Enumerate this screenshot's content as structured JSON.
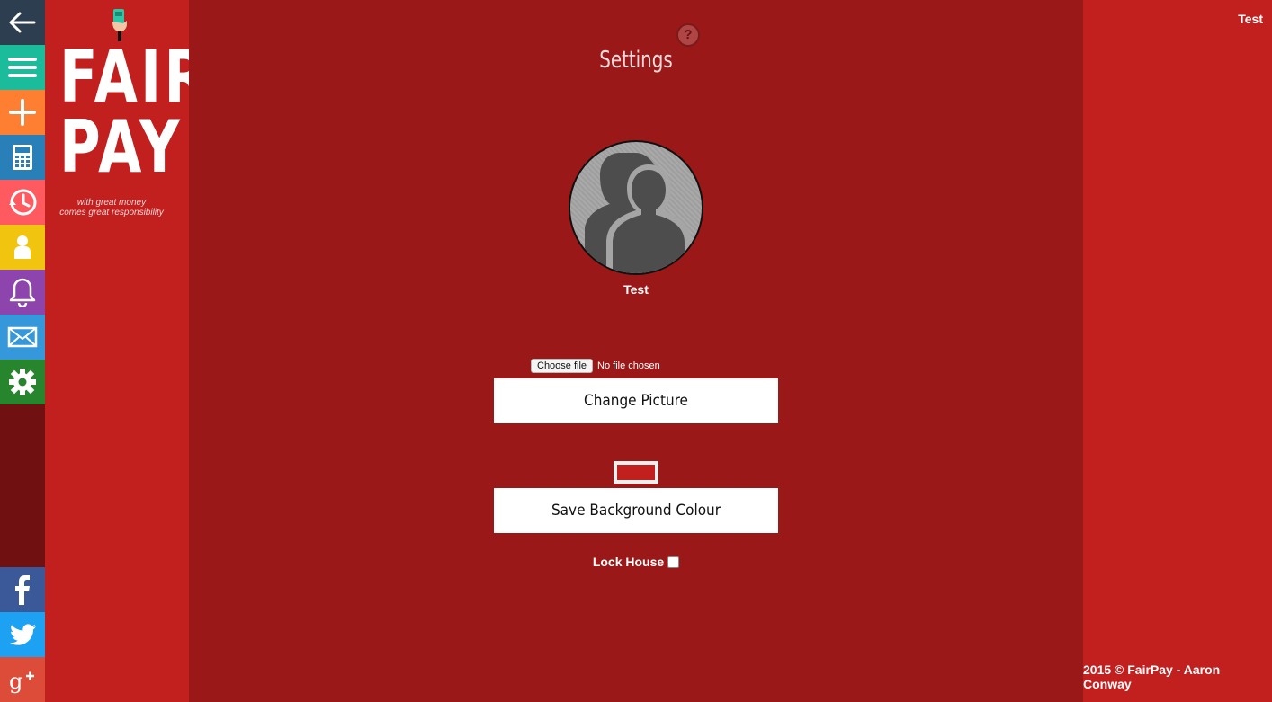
{
  "colors": {
    "rail_back": "#2c3e50",
    "rail_menu": "#1abc9c",
    "rail_add": "#ff7f32",
    "rail_calc": "#2980b9",
    "rail_history": "#ff5a5f",
    "rail_user": "#f1c40f",
    "rail_bell": "#8e44ad",
    "rail_mail": "#3498db",
    "rail_settings": "#27852d",
    "rail_facebook": "#3b5998",
    "rail_twitter": "#1da1f2",
    "rail_gplus": "#dd4b39",
    "main_bg": "#9b1818",
    "side_bg": "#c21f1f",
    "selected_background_colour": "#c21f1f"
  },
  "rail": [
    {
      "name": "back",
      "icon": "arrow-left-icon"
    },
    {
      "name": "menu",
      "icon": "hamburger-icon"
    },
    {
      "name": "add",
      "icon": "plus-icon"
    },
    {
      "name": "calculator",
      "icon": "calculator-icon"
    },
    {
      "name": "history",
      "icon": "clock-icon"
    },
    {
      "name": "profile",
      "icon": "user-icon"
    },
    {
      "name": "notifications",
      "icon": "bell-icon"
    },
    {
      "name": "messages",
      "icon": "mail-icon"
    },
    {
      "name": "settings",
      "icon": "gear-icon"
    },
    {
      "name": "facebook",
      "icon": "facebook-icon"
    },
    {
      "name": "twitter",
      "icon": "twitter-icon"
    },
    {
      "name": "google-plus",
      "icon": "google-plus-icon"
    }
  ],
  "logo": {
    "line1": "FAIR",
    "line2": "PAY",
    "tagline1": "with great money",
    "tagline2": "comes great responsibility"
  },
  "header": {
    "user_name": "Test",
    "help_glyph": "?"
  },
  "settings": {
    "title": "Settings",
    "profile_name": "Test",
    "file_button": "Choose file",
    "file_status": "No file chosen",
    "change_picture": "Change Picture",
    "save_background": "Save Background Colour",
    "lock_house": "Lock House",
    "lock_house_checked": false
  },
  "footer": {
    "text": "2015 © FairPay - Aaron Conway"
  }
}
